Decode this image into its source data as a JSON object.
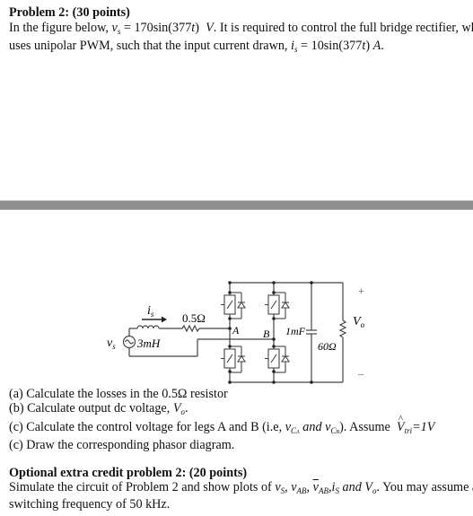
{
  "problem": {
    "title": "Problem 2: (30 points)",
    "line1_prefix": "In the figure below, ",
    "vs_symbol": "v",
    "vs_sub": "s",
    "vs_expr": " = 170sin(377",
    "t_var": "t",
    "vs_unit_close": ")",
    "vs_unit": "V",
    "line1_suffix": ". It is required to control the full bridge rectifier, which",
    "line2_prefix": "uses unipolar PWM, such that the input current drawn, ",
    "is_symbol": "i",
    "is_sub": "s",
    "is_expr": " = 10sin(377",
    "is_close": ")",
    "is_unit": "A",
    "line2_suffix": "."
  },
  "separator": {
    "color": "#8f8f8f"
  },
  "circuit": {
    "source_label": "v",
    "source_sub": "s",
    "current_label": "i",
    "current_sub": "s",
    "inductor_label": "3mH",
    "resistor_label": "0.5Ω",
    "node_a": "A",
    "node_b": "B",
    "capacitor_label": "1mF",
    "load_label": "60Ω",
    "output_label": "V",
    "output_sub": "o",
    "plus": "+",
    "minus": "–"
  },
  "questions": {
    "a": "(a) Calculate the losses in the 0.5Ω resistor",
    "b_prefix": "(b) Calculate output dc voltage, ",
    "b_var": "V",
    "b_sub": "o",
    "b_suffix": ".",
    "c_prefix": "(c) Calculate the control voltage for legs A and B (i.e, ",
    "c_var1": "v",
    "c_sub1": "C",
    "c_subsub1": "A",
    "c_and": " and ",
    "c_var2": "v",
    "c_sub2": "C",
    "c_subsub2": "B",
    "c_mid": "). Assume ",
    "c_vtri": "V",
    "c_vtri_sub": "tri",
    "c_vtri_val": "=1V",
    "d": "(c) Draw the corresponding phasor diagram."
  },
  "extra": {
    "title": "Optional extra credit problem 2: (20 points)",
    "line1_prefix": "Simulate the circuit of Problem 2 and show plots of ",
    "v1": "v",
    "v1_sub": "S",
    "v2": "v",
    "v2_sub": "AB",
    "v3": "v",
    "v3_sub": "AB",
    "v4": "i",
    "v4_sub": "S",
    "and_text": " and ",
    "v5": "V",
    "v5_sub": "o",
    "line1_suffix": ".  You may assume a",
    "line2": "switching frequency of 50 kHz."
  }
}
